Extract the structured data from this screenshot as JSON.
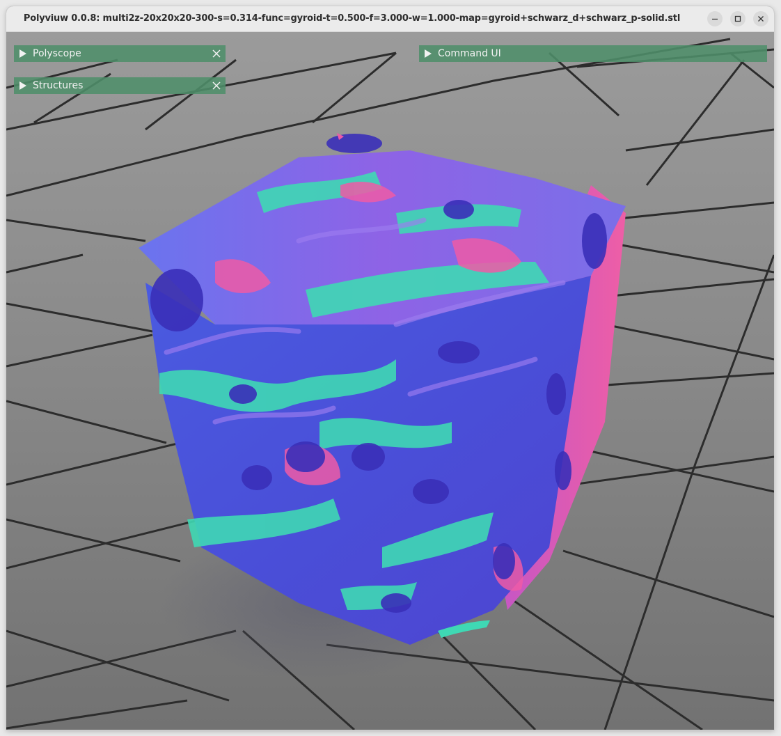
{
  "window": {
    "title": "Polyviuw 0.0.8: multi2z-20x20x20-300-s=0.314-func=gyroid-t=0.500-f=3.000-w=1.000-map=gyroid+schwarz_d+schwarz_p-solid.stl",
    "controls": [
      "minimize-icon",
      "maximize-icon",
      "close-icon"
    ]
  },
  "panels": {
    "polyscope": {
      "label": "Polyscope",
      "expanded": false,
      "closable": true
    },
    "structures": {
      "label": "Structures",
      "expanded": false,
      "closable": true
    },
    "command_ui": {
      "label": "Command UI",
      "expanded": false,
      "closable": false
    }
  },
  "scene": {
    "ground": "tiled gray floor grid",
    "object": "triply periodic minimal surface lattice mesh (gyroid / schwarz blend) with normal-map coloring",
    "colors": {
      "blue": "#4848dc",
      "violet": "#8a5ae6",
      "teal": "#3fd8b4",
      "pink": "#ee5aa6",
      "panel": "#4e8e6a"
    }
  }
}
